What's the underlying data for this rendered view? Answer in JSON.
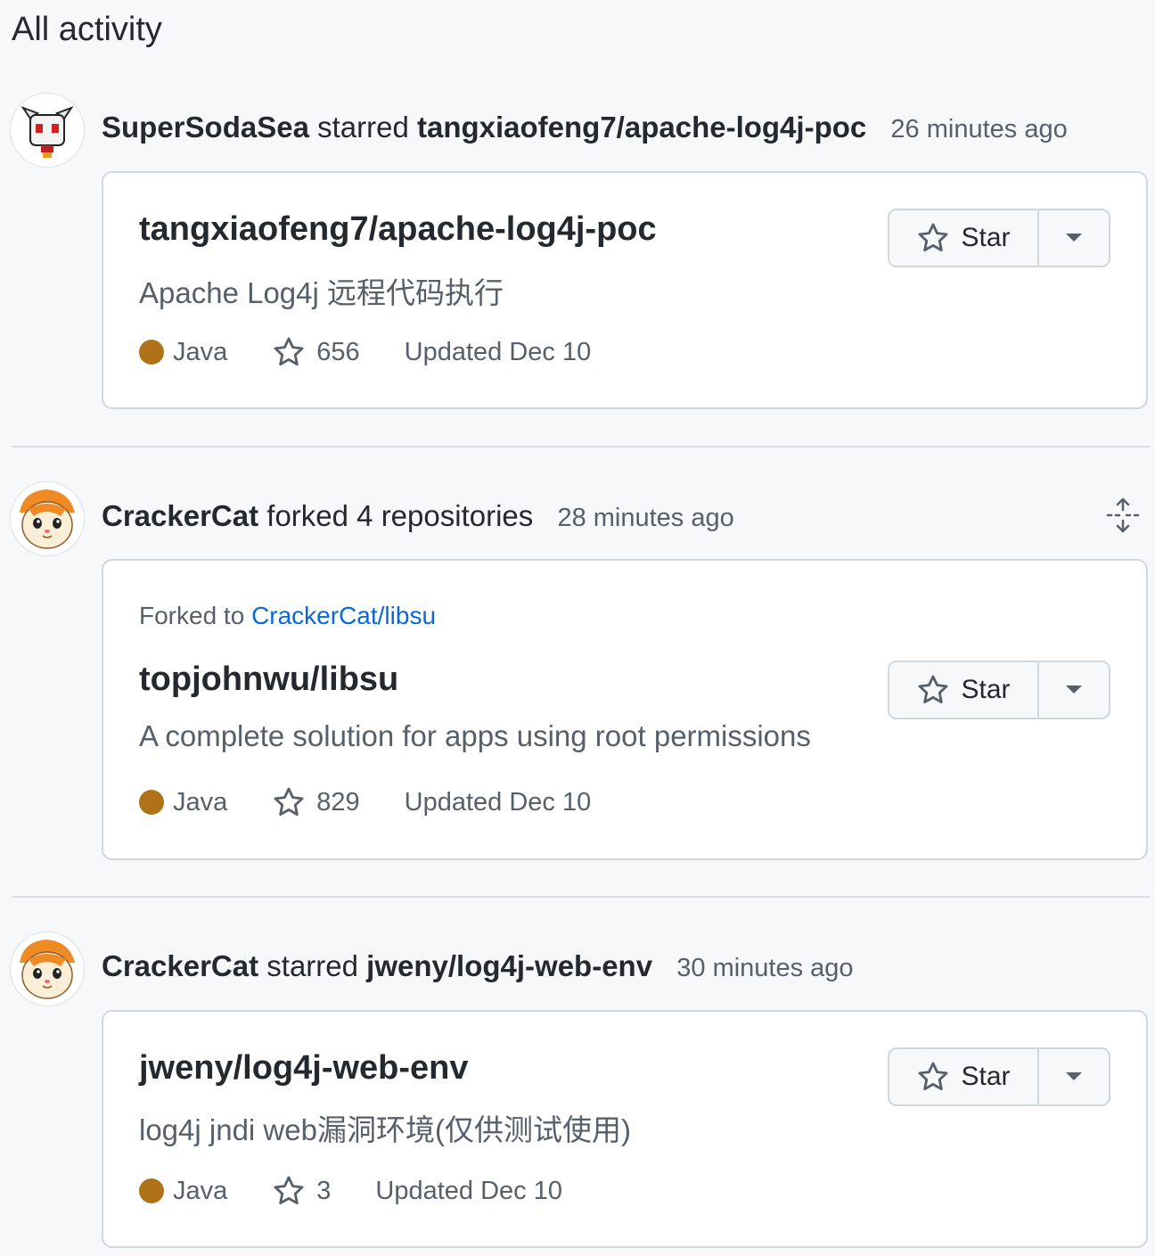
{
  "page": {
    "title": "All activity"
  },
  "colors": {
    "java": "#b07219",
    "link": "#0969da",
    "muted": "#57606a"
  },
  "events": [
    {
      "actor": "SuperSodaSea",
      "action": "starred",
      "target": "tangxiaofeng7/apache-log4j-poc",
      "time": "26 minutes ago",
      "repo": {
        "name": "tangxiaofeng7/apache-log4j-poc",
        "description": "Apache Log4j 远程代码执行",
        "language": "Java",
        "stars": "656",
        "updated": "Updated Dec 10",
        "star_label": "Star"
      }
    },
    {
      "actor": "CrackerCat",
      "action": "forked 4 repositories",
      "time": "28 minutes ago",
      "forked_prefix": "Forked to",
      "forked_link": "CrackerCat/libsu",
      "repo": {
        "name": "topjohnwu/libsu",
        "description": "A complete solution for apps using root permissions",
        "language": "Java",
        "stars": "829",
        "updated": "Updated Dec 10",
        "star_label": "Star"
      }
    },
    {
      "actor": "CrackerCat",
      "action": "starred",
      "target": "jweny/log4j-web-env",
      "time": "30 minutes ago",
      "repo": {
        "name": "jweny/log4j-web-env",
        "description": "log4j jndi web漏洞环境(仅供测试使用)",
        "language": "Java",
        "stars": "3",
        "updated": "Updated Dec 10",
        "star_label": "Star"
      }
    }
  ]
}
